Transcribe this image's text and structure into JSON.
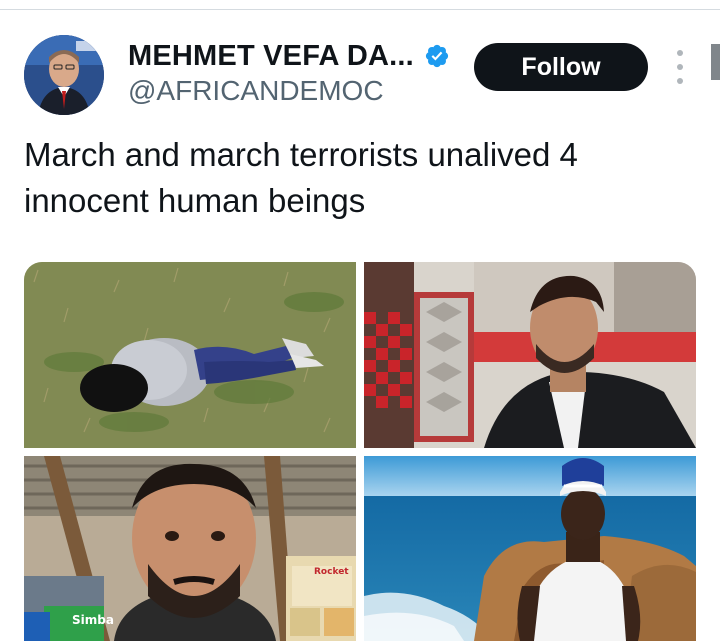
{
  "tweet": {
    "author": {
      "display_name": "MEHMET VEFA DA...",
      "handle": "@AFRICANDEMOC",
      "verified": true,
      "avatar_icon": "profile-photo"
    },
    "follow_label": "Follow",
    "more_icon": "more-options-icon",
    "text_lines": [
      "March and march terrorists unalived 4",
      "innocent human beings"
    ],
    "media": [
      {
        "description_icon": "photo-victim-on-grass"
      },
      {
        "description_icon": "photo-man-in-cafe"
      },
      {
        "description_icon": "photo-man-selfie-in-shop",
        "package_text_1": "Simba",
        "package_text_2": "Rocket"
      },
      {
        "description_icon": "photo-young-man-by-sea"
      }
    ]
  },
  "colors": {
    "text": "#0f1419",
    "secondary_text": "#536471",
    "follow_bg": "#0f1419",
    "verified": "#1d9bf0",
    "divider": "#d5dbe0"
  }
}
